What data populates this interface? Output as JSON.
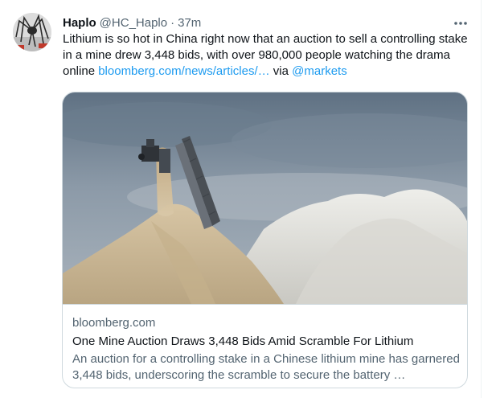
{
  "tweet": {
    "display_name": "Haplo",
    "handle": "@HC_Haplo",
    "separator": "·",
    "time": "37m",
    "more_icon": "more-horizontal-icon",
    "text_main": "Lithium is so hot in China right now that an auction to sell a controlling stake in a mine drew 3,448 bids, with over 980,000 people watching the drama online ",
    "link_text": "bloomberg.com/news/articles/…",
    "via_text": " via ",
    "mention": "@markets"
  },
  "card": {
    "domain": "bloomberg.com",
    "title": "One Mine Auction Draws 3,448 Bids Amid Scramble For Lithium",
    "description": "An auction for a controlling stake in a Chinese lithium mine has garnered 3,448 bids, underscoring the scramble to secure the battery …"
  },
  "colors": {
    "link": "#1d9bf0",
    "secondary_text": "#536471",
    "primary_text": "#0f1419",
    "border": "#cfd9de"
  }
}
